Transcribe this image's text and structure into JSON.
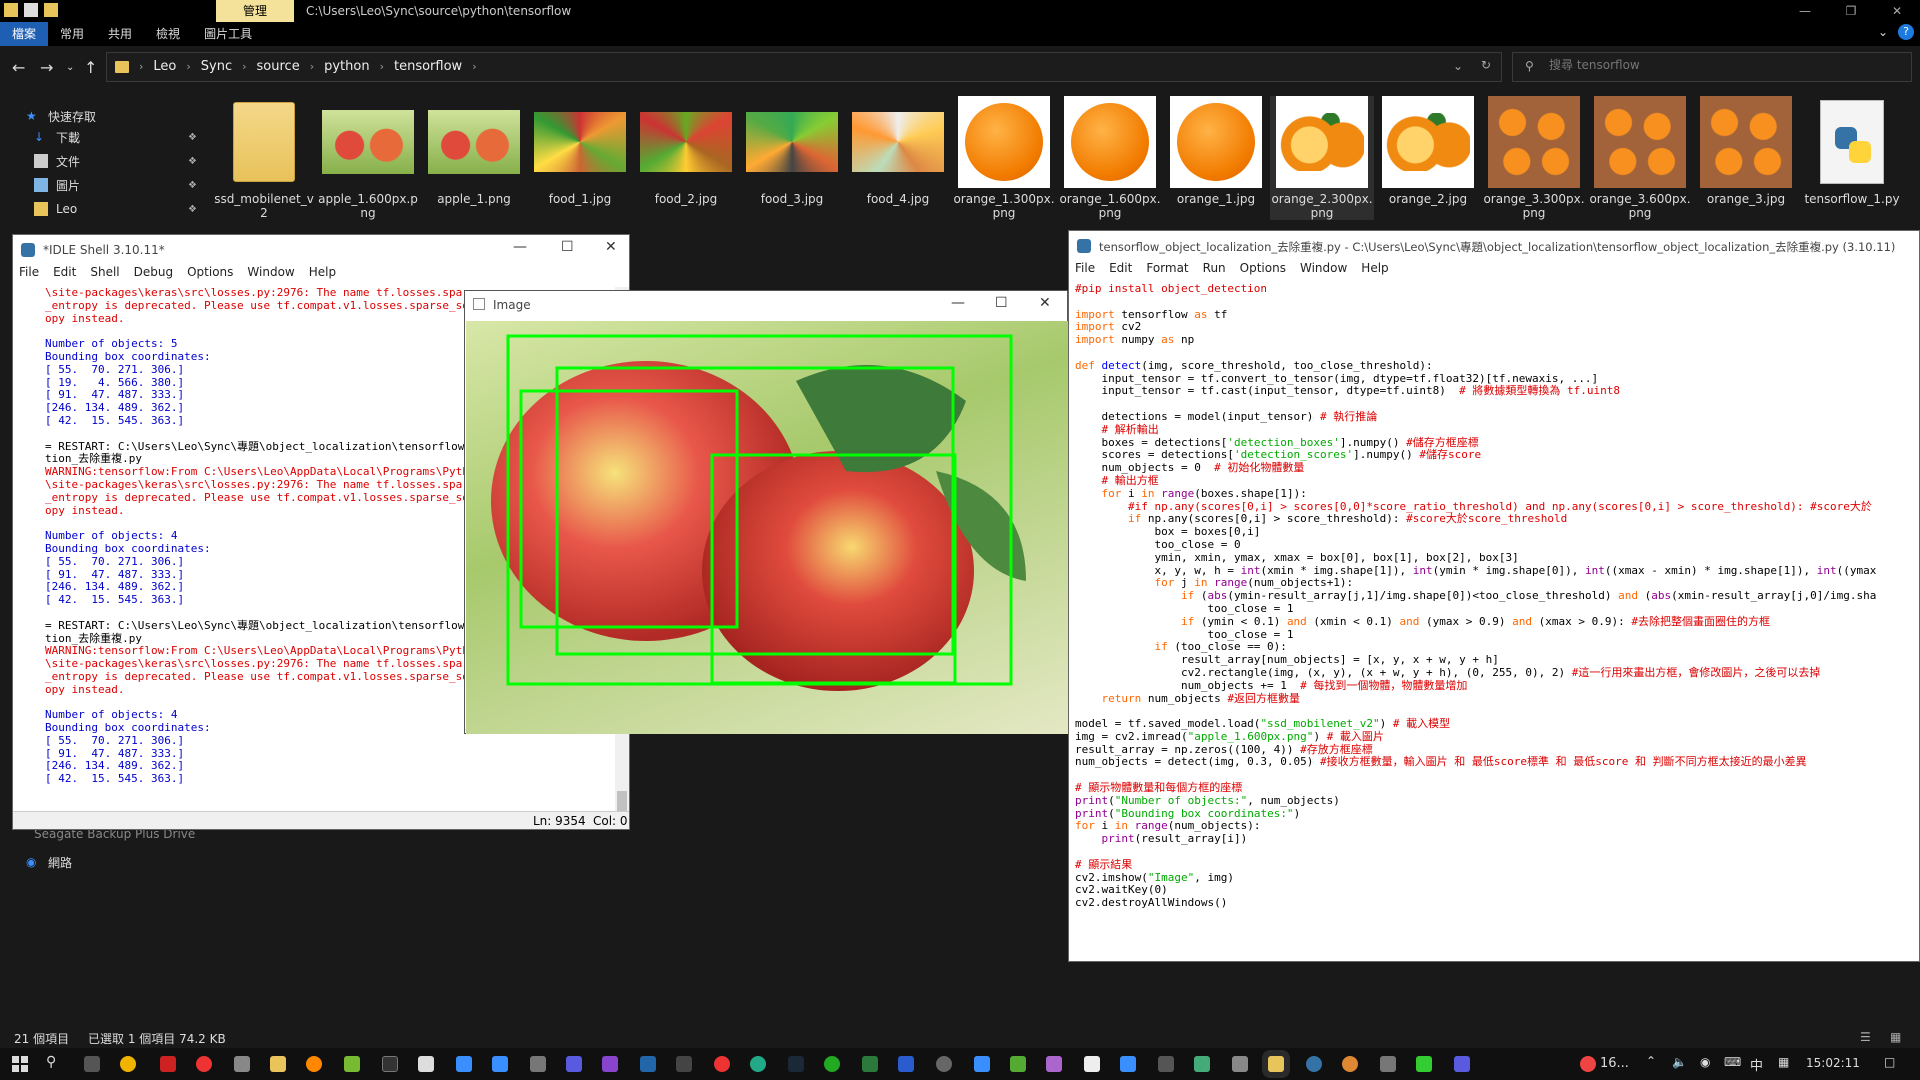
{
  "explorer": {
    "title_path": "C:\\Users\\Leo\\Sync\\source\\python\\tensorflow",
    "manage_tab": "管理",
    "ribbon_tabs": [
      "檔案",
      "常用",
      "共用",
      "檢視",
      "圖片工具"
    ],
    "breadcrumbs": [
      "Leo",
      "Sync",
      "source",
      "python",
      "tensorflow"
    ],
    "search_placeholder": "搜尋 tensorflow",
    "nav": {
      "quick_access": "快速存取",
      "downloads": "下載",
      "documents": "文件",
      "pictures": "圖片",
      "leo": "Leo",
      "seagate": "Seagate Backup Plus Drive",
      "network": "網路"
    },
    "files": [
      {
        "name": "ssd_mobilenet_v2",
        "type": "folder"
      },
      {
        "name": "apple_1.600px.png",
        "type": "apple"
      },
      {
        "name": "apple_1.png",
        "type": "apple"
      },
      {
        "name": "food_1.jpg",
        "type": "food"
      },
      {
        "name": "food_2.jpg",
        "type": "food"
      },
      {
        "name": "food_3.jpg",
        "type": "food"
      },
      {
        "name": "food_4.jpg",
        "type": "food"
      },
      {
        "name": "orange_1.300px.png",
        "type": "orange"
      },
      {
        "name": "orange_1.600px.png",
        "type": "orange"
      },
      {
        "name": "orange_1.jpg",
        "type": "orange"
      },
      {
        "name": "orange_2.300px.png",
        "type": "orange-half"
      },
      {
        "name": "orange_2.jpg",
        "type": "orange-half"
      },
      {
        "name": "orange_3.300px.png",
        "type": "orange-wood"
      },
      {
        "name": "orange_3.600px.png",
        "type": "orange-wood"
      },
      {
        "name": "orange_3.jpg",
        "type": "orange-wood"
      },
      {
        "name": "tensorflow_1.py",
        "type": "python"
      }
    ],
    "status": {
      "items": "21 個項目",
      "selected": "已選取 1 個項目 74.2 KB"
    }
  },
  "shell": {
    "title": "*IDLE Shell 3.10.11*",
    "menu": [
      "File",
      "Edit",
      "Shell",
      "Debug",
      "Options",
      "Window",
      "Help"
    ],
    "lines": [
      {
        "c": "red",
        "t": "\\site-packages\\keras\\src\\losses.py:2976: The name tf.losses.sparse_softmax_cross"
      },
      {
        "c": "red",
        "t": "_entropy is deprecated. Please use tf.compat.v1.losses.sparse_softmax_cross_entr"
      },
      {
        "c": "red",
        "t": "opy instead."
      },
      {
        "c": "black",
        "t": ""
      },
      {
        "c": "blue",
        "t": "Number of objects: 5"
      },
      {
        "c": "blue",
        "t": "Bounding box coordinates:"
      },
      {
        "c": "blue",
        "t": "[ 55.  70. 271. 306.]"
      },
      {
        "c": "blue",
        "t": "[ 19.   4. 566. 380.]"
      },
      {
        "c": "blue",
        "t": "[ 91.  47. 487. 333.]"
      },
      {
        "c": "blue",
        "t": "[246. 134. 489. 362.]"
      },
      {
        "c": "blue",
        "t": "[ 42.  15. 545. 363.]"
      },
      {
        "c": "black",
        "t": ""
      },
      {
        "c": "black",
        "t": "= RESTART: C:\\Users\\Leo\\Sync\\專題\\object_localization\\tensorflow_object_localiza"
      },
      {
        "c": "black",
        "t": "tion_去除重複.py"
      },
      {
        "c": "red",
        "t": "WARNING:tensorflow:From C:\\Users\\Leo\\AppData\\Local\\Programs\\Python\\Python310\\lib"
      },
      {
        "c": "red",
        "t": "\\site-packages\\keras\\src\\losses.py:2976: The name tf.losses.sparse_softmax_cross"
      },
      {
        "c": "red",
        "t": "_entropy is deprecated. Please use tf.compat.v1.losses.sparse_softmax_cross_entr"
      },
      {
        "c": "red",
        "t": "opy instead."
      },
      {
        "c": "black",
        "t": ""
      },
      {
        "c": "blue",
        "t": "Number of objects: 4"
      },
      {
        "c": "blue",
        "t": "Bounding box coordinates:"
      },
      {
        "c": "blue",
        "t": "[ 55.  70. 271. 306.]"
      },
      {
        "c": "blue",
        "t": "[ 91.  47. 487. 333.]"
      },
      {
        "c": "blue",
        "t": "[246. 134. 489. 362.]"
      },
      {
        "c": "blue",
        "t": "[ 42.  15. 545. 363.]"
      },
      {
        "c": "black",
        "t": ""
      },
      {
        "c": "black",
        "t": "= RESTART: C:\\Users\\Leo\\Sync\\專題\\object_localization\\tensorflow_object_localiza"
      },
      {
        "c": "black",
        "t": "tion_去除重複.py"
      },
      {
        "c": "red",
        "t": "WARNING:tensorflow:From C:\\Users\\Leo\\AppData\\Local\\Programs\\Python\\Python310\\lib"
      },
      {
        "c": "red",
        "t": "\\site-packages\\keras\\src\\losses.py:2976: The name tf.losses.sparse_softmax_cross"
      },
      {
        "c": "red",
        "t": "_entropy is deprecated. Please use tf.compat.v1.losses.sparse_softmax_cross_entr"
      },
      {
        "c": "red",
        "t": "opy instead."
      },
      {
        "c": "black",
        "t": ""
      },
      {
        "c": "blue",
        "t": "Number of objects: 4"
      },
      {
        "c": "blue",
        "t": "Bounding box coordinates:"
      },
      {
        "c": "blue",
        "t": "[ 55.  70. 271. 306.]"
      },
      {
        "c": "blue",
        "t": "[ 91.  47. 487. 333.]"
      },
      {
        "c": "blue",
        "t": "[246. 134. 489. 362.]"
      },
      {
        "c": "blue",
        "t": "[ 42.  15. 545. 363.]"
      }
    ],
    "status_ln": "Ln: 9354",
    "status_col": "Col: 0"
  },
  "image_window": {
    "title": "Image",
    "boxes": [
      [
        55,
        70,
        271,
        306
      ],
      [
        91,
        47,
        487,
        333
      ],
      [
        246,
        134,
        489,
        362
      ],
      [
        42,
        15,
        545,
        363
      ]
    ]
  },
  "editor": {
    "title": "tensorflow_object_localization_去除重複.py - C:\\Users\\Leo\\Sync\\專題\\object_localization\\tensorflow_object_localization_去除重複.py (3.10.11)",
    "menu": [
      "File",
      "Edit",
      "Format",
      "Run",
      "Options",
      "Window",
      "Help"
    ],
    "lines": [
      [
        [
          "cm",
          "#pip install object_detection"
        ]
      ],
      [
        [
          "",
          ""
        ]
      ],
      [
        [
          "kw",
          "import"
        ],
        [
          "",
          " tensorflow "
        ],
        [
          "kw",
          "as"
        ],
        [
          "",
          " tf"
        ]
      ],
      [
        [
          "kw",
          "import"
        ],
        [
          "",
          " cv2"
        ]
      ],
      [
        [
          "kw",
          "import"
        ],
        [
          "",
          " numpy "
        ],
        [
          "kw",
          "as"
        ],
        [
          "",
          " np"
        ]
      ],
      [
        [
          "",
          ""
        ]
      ],
      [
        [
          "kw",
          "def"
        ],
        [
          "fn",
          " detect"
        ],
        [
          "",
          "(img, score_threshold, too_close_threshold):"
        ]
      ],
      [
        [
          "",
          "    input_tensor = tf.convert_to_tensor(img, dtype=tf.float32)[tf.newaxis, ...]"
        ]
      ],
      [
        [
          "",
          "    input_tensor = tf.cast(input_tensor, dtype=tf.uint8)  "
        ],
        [
          "cm",
          "# 將數據類型轉換為 tf.uint8"
        ]
      ],
      [
        [
          "",
          ""
        ]
      ],
      [
        [
          "",
          "    detections = model(input_tensor) "
        ],
        [
          "cm",
          "# 執行推論"
        ]
      ],
      [
        [
          "cm",
          "    # 解析輸出"
        ]
      ],
      [
        [
          "",
          "    boxes = detections["
        ],
        [
          "str",
          "'detection_boxes'"
        ],
        [
          "",
          "].numpy() "
        ],
        [
          "cm",
          "#儲存方框座標"
        ]
      ],
      [
        [
          "",
          "    scores = detections["
        ],
        [
          "str",
          "'detection_scores'"
        ],
        [
          "",
          "].numpy() "
        ],
        [
          "cm",
          "#儲存score"
        ]
      ],
      [
        [
          "",
          "    num_objects = 0  "
        ],
        [
          "cm",
          "# 初始化物體數量"
        ]
      ],
      [
        [
          "cm",
          "    # 輸出方框"
        ]
      ],
      [
        [
          "kw",
          "    for"
        ],
        [
          "",
          " i "
        ],
        [
          "kw",
          "in"
        ],
        [
          "bi",
          " range"
        ],
        [
          "",
          "(boxes.shape[1]):"
        ]
      ],
      [
        [
          "cm",
          "        #if np.any(scores[0,i] > scores[0,0]*score_ratio_threshold) and np.any(scores[0,i] > score_threshold): #score大於"
        ]
      ],
      [
        [
          "kw",
          "        if"
        ],
        [
          "",
          " np.any(scores[0,i] > score_threshold): "
        ],
        [
          "cm",
          "#score大於score_threshold"
        ]
      ],
      [
        [
          "",
          "            box = boxes[0,i]"
        ]
      ],
      [
        [
          "",
          "            too_close = 0"
        ]
      ],
      [
        [
          "",
          "            ymin, xmin, ymax, xmax = box[0], box[1], box[2], box[3]"
        ]
      ],
      [
        [
          "",
          "            x, y, w, h = "
        ],
        [
          "bi",
          "int"
        ],
        [
          "",
          "(xmin * img.shape[1]), "
        ],
        [
          "bi",
          "int"
        ],
        [
          "",
          "(ymin * img.shape[0]), "
        ],
        [
          "bi",
          "int"
        ],
        [
          "",
          "((xmax - xmin) * img.shape[1]), "
        ],
        [
          "bi",
          "int"
        ],
        [
          "",
          "((ymax"
        ]
      ],
      [
        [
          "kw",
          "            for"
        ],
        [
          "",
          " j "
        ],
        [
          "kw",
          "in"
        ],
        [
          "bi",
          " range"
        ],
        [
          "",
          "(num_objects+1):"
        ]
      ],
      [
        [
          "kw",
          "                if"
        ],
        [
          "",
          " ("
        ],
        [
          "bi",
          "abs"
        ],
        [
          "",
          "(ymin-result_array[j,1]/img.shape[0])<too_close_threshold) "
        ],
        [
          "kw",
          "and"
        ],
        [
          "",
          " ("
        ],
        [
          "bi",
          "abs"
        ],
        [
          "",
          "(xmin-result_array[j,0]/img.sha"
        ]
      ],
      [
        [
          "",
          "                    too_close = 1"
        ]
      ],
      [
        [
          "kw",
          "                if"
        ],
        [
          "",
          " (ymin < 0.1) "
        ],
        [
          "kw",
          "and"
        ],
        [
          "",
          " (xmin < 0.1) "
        ],
        [
          "kw",
          "and"
        ],
        [
          "",
          " (ymax > 0.9) "
        ],
        [
          "kw",
          "and"
        ],
        [
          "",
          " (xmax > 0.9): "
        ],
        [
          "cm",
          "#去除把整個畫面圈住的方框"
        ]
      ],
      [
        [
          "",
          "                    too_close = 1"
        ]
      ],
      [
        [
          "kw",
          "            if"
        ],
        [
          "",
          " (too_close == 0):"
        ]
      ],
      [
        [
          "",
          "                result_array[num_objects] = [x, y, x + w, y + h]"
        ]
      ],
      [
        [
          "",
          "                cv2.rectangle(img, (x, y), (x + w, y + h), (0, 255, 0), 2) "
        ],
        [
          "cm",
          "#這一行用來畫出方框，會修改圖片，之後可以去掉"
        ]
      ],
      [
        [
          "",
          "                num_objects += 1  "
        ],
        [
          "cm",
          "# 每找到一個物體，物體數量增加"
        ]
      ],
      [
        [
          "kw",
          "    return"
        ],
        [
          "",
          " num_objects "
        ],
        [
          "cm",
          "#返回方框數量"
        ]
      ],
      [
        [
          "",
          ""
        ]
      ],
      [
        [
          "",
          "model = tf.saved_model.load("
        ],
        [
          "str",
          "\"ssd_mobilenet_v2\""
        ],
        [
          "",
          ") "
        ],
        [
          "cm",
          "# 載入模型"
        ]
      ],
      [
        [
          "",
          "img = cv2.imread("
        ],
        [
          "str",
          "\"apple_1.600px.png\""
        ],
        [
          "",
          ") "
        ],
        [
          "cm",
          "# 載入圖片"
        ]
      ],
      [
        [
          "",
          "result_array = np.zeros((100, 4)) "
        ],
        [
          "cm",
          "#存放方框座標"
        ]
      ],
      [
        [
          "",
          "num_objects = detect(img, 0.3, 0.05) "
        ],
        [
          "cm",
          "#接收方框數量，輸入圖片 和 最低score標準 和 最低score 和 判斷不同方框太接近的最小差異"
        ]
      ],
      [
        [
          "",
          ""
        ]
      ],
      [
        [
          "cm",
          "# 顯示物體數量和每個方框的座標"
        ]
      ],
      [
        [
          "bi",
          "print"
        ],
        [
          "",
          "("
        ],
        [
          "str",
          "\"Number of objects:\""
        ],
        [
          "",
          ", num_objects)"
        ]
      ],
      [
        [
          "bi",
          "print"
        ],
        [
          "",
          "("
        ],
        [
          "str",
          "\"Bounding box coordinates:\""
        ],
        [
          "",
          ")"
        ]
      ],
      [
        [
          "kw",
          "for"
        ],
        [
          "",
          " i "
        ],
        [
          "kw",
          "in"
        ],
        [
          "bi",
          " range"
        ],
        [
          "",
          "(num_objects):"
        ]
      ],
      [
        [
          "bi",
          "    print"
        ],
        [
          "",
          "(result_array[i])"
        ]
      ],
      [
        [
          "",
          ""
        ]
      ],
      [
        [
          "cm",
          "# 顯示結果"
        ]
      ],
      [
        [
          "",
          "cv2.imshow("
        ],
        [
          "str",
          "\"Image\""
        ],
        [
          "",
          ", img)"
        ]
      ],
      [
        [
          "",
          "cv2.waitKey(0)"
        ]
      ],
      [
        [
          "",
          "cv2.destroyAllWindows()"
        ]
      ]
    ]
  },
  "taskbar": {
    "weather": "16...",
    "ime": "中",
    "time": "15:02:11"
  }
}
